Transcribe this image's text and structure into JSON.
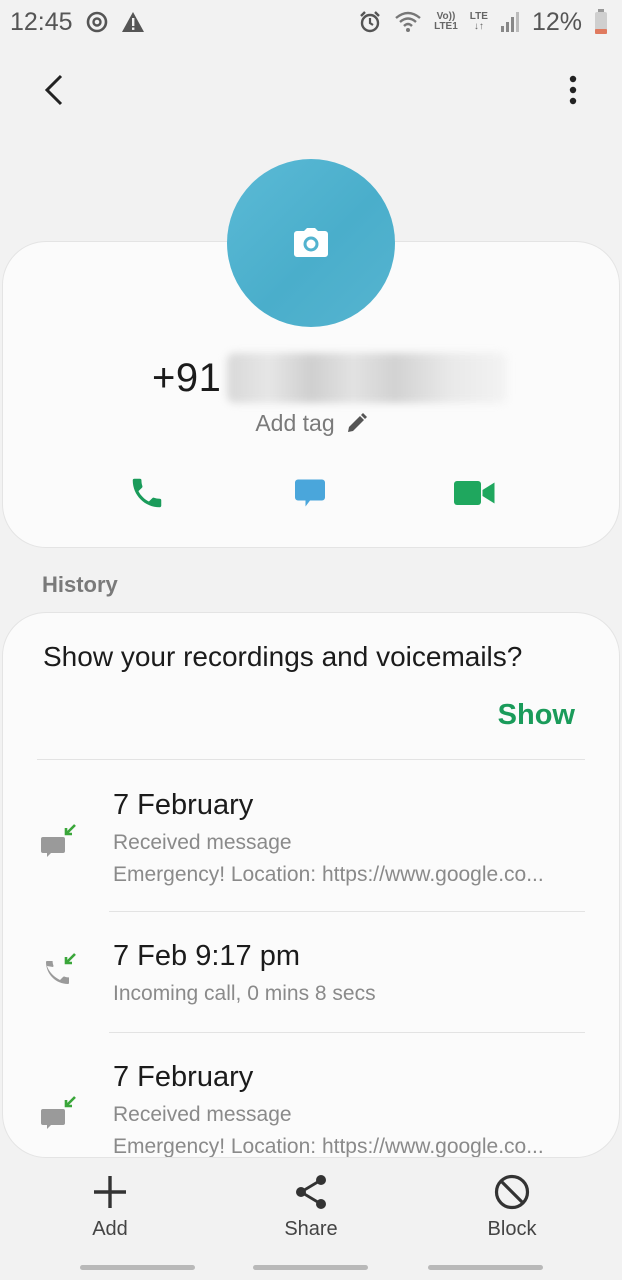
{
  "status_bar": {
    "time": "12:45",
    "network_top": "Vo))",
    "network_bottom": "LTE1",
    "lte_label": "LTE",
    "battery": "12%"
  },
  "contact": {
    "number_prefix": "+91",
    "add_tag_label": "Add tag",
    "avatar_color": "#52b3cf",
    "call_color": "#1a9b5a",
    "message_color": "#4aa6db",
    "video_color": "#1fa75e"
  },
  "history": {
    "section_label": "History",
    "prompt": "Show your recordings and voicemails?",
    "show_label": "Show",
    "entries": [
      {
        "title": "7 February",
        "subtitle": "Received message",
        "detail": "Emergency! Location: https://www.google.co...",
        "icon": "incoming-message-icon"
      },
      {
        "title": "7 Feb 9:17 pm",
        "subtitle": "Incoming call, 0 mins 8 secs",
        "icon": "incoming-call-icon"
      },
      {
        "title": "7 February",
        "subtitle": "Received message",
        "detail": "Emergency! Location: https://www.google.co...",
        "icon": "incoming-message-icon"
      }
    ]
  },
  "bottom_bar": {
    "add_label": "Add",
    "share_label": "Share",
    "block_label": "Block"
  }
}
